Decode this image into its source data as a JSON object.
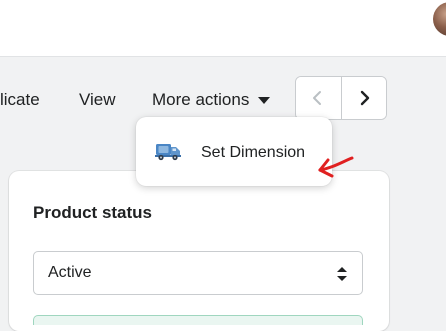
{
  "header": {
    "avatar_icon": "user-avatar"
  },
  "page_actions": {
    "duplicate_label": "licate",
    "view_label": "View",
    "more_actions_label": "More actions",
    "more_actions_icon": "caret-down-icon",
    "prev_icon": "chevron-left-icon",
    "next_icon": "chevron-right-icon"
  },
  "more_actions_menu": {
    "items": [
      {
        "label": "Set Dimension",
        "icon": "delivery-truck-icon"
      }
    ]
  },
  "annotation": {
    "icon": "red-arrow-annotation",
    "color": "#e02020"
  },
  "product_status_card": {
    "title": "Product status",
    "status_select": {
      "value": "Active",
      "icon": "select-updown-icon"
    }
  },
  "colors": {
    "page_bg": "#f1f2f3",
    "surface": "#ffffff",
    "text": "#202223",
    "border": "#c9cccf",
    "truck_blue": "#4a86c5"
  }
}
